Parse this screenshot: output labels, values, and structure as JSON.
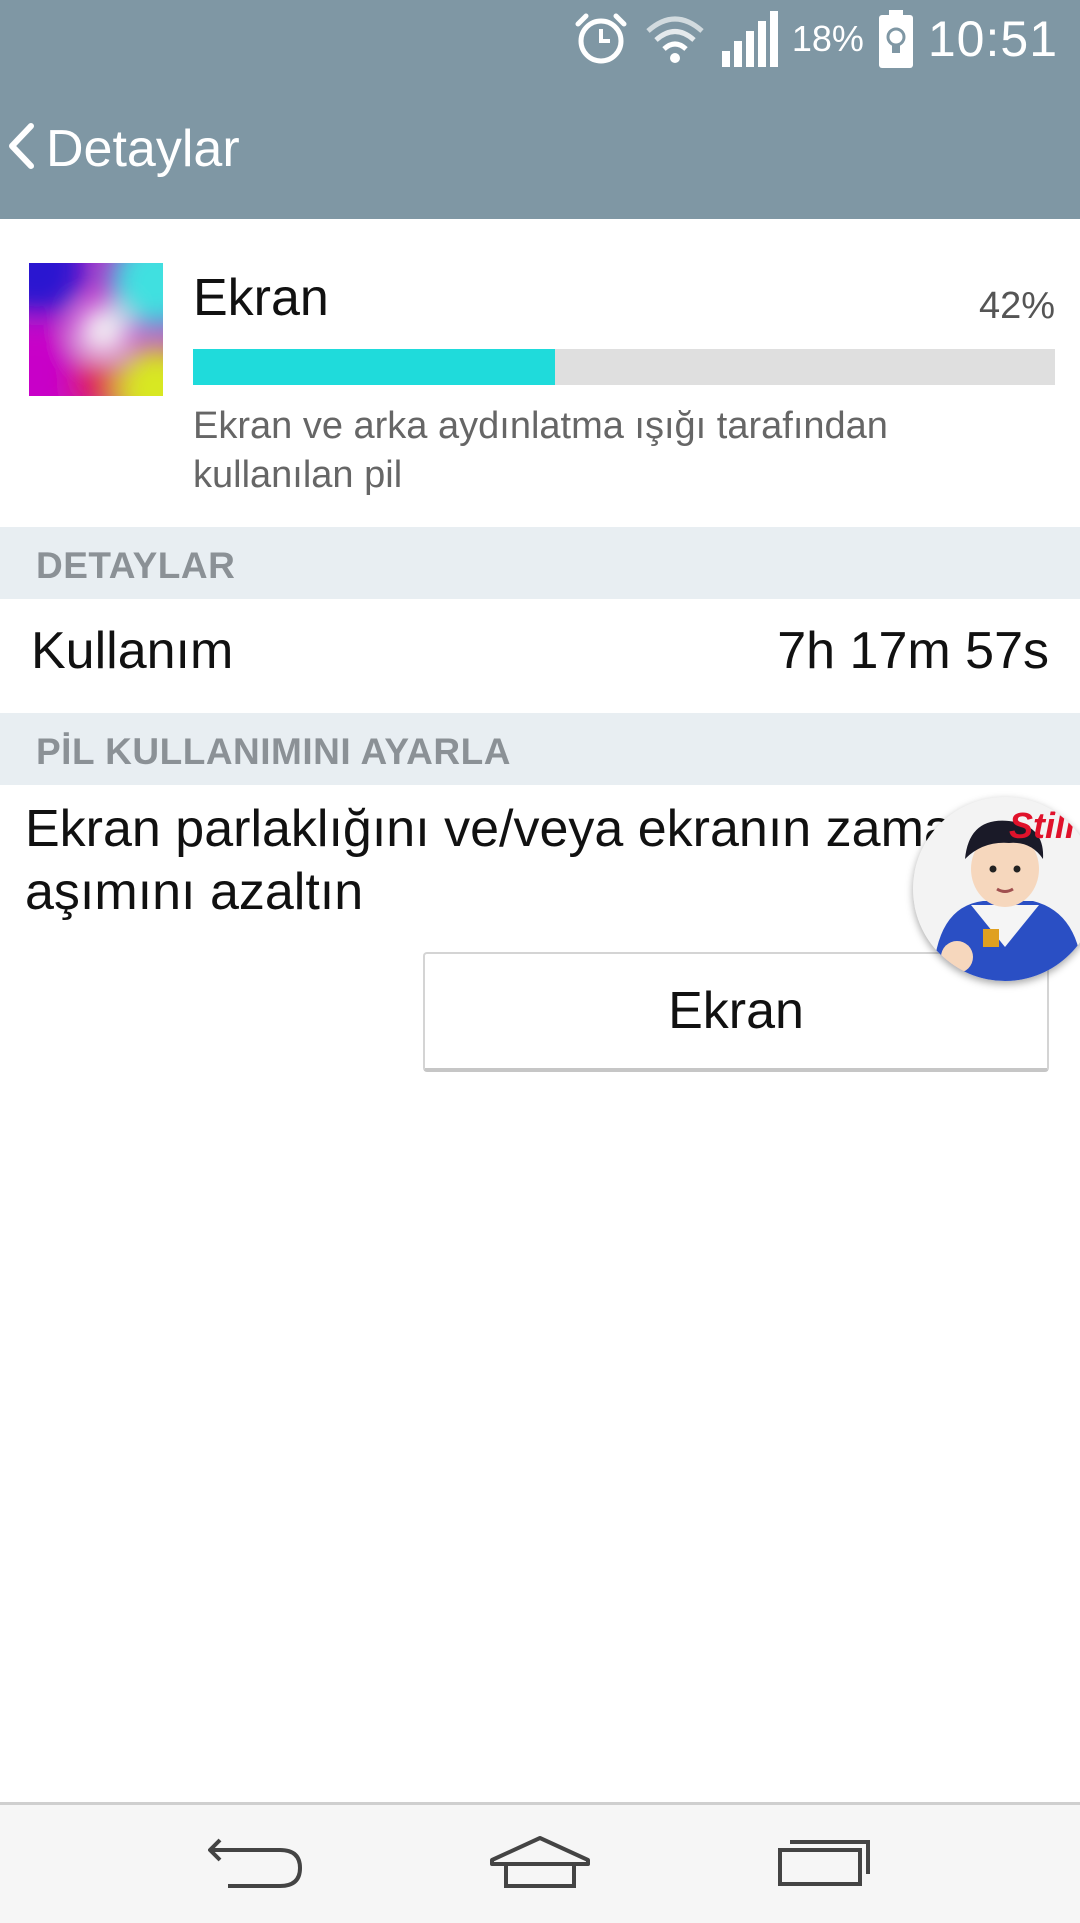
{
  "status_bar": {
    "battery_percent": "18%",
    "time": "10:51",
    "icons": [
      "alarm-icon",
      "wifi-icon",
      "signal-icon",
      "battery-icon"
    ]
  },
  "action_bar": {
    "back_icon": "chevron-left-icon",
    "title": "Detaylar"
  },
  "summary": {
    "title": "Ekran",
    "percent_label": "42%",
    "usage_fraction": 0.42,
    "description": "Ekran ve arka aydınlatma ışığı tarafından kullanılan pil",
    "bar_fill_color": "#1fdbdb",
    "bar_track_color": "#dfdfdf"
  },
  "details_section": {
    "header": "DETAYLAR",
    "rows": [
      {
        "label": "Kullanım",
        "value": "7h 17m 57s"
      }
    ]
  },
  "adjust_section": {
    "header": "PİL KULLANIMINI AYARLA",
    "tip": "Ekran parlaklığını ve/veya ekranın zaman aşımını azaltın",
    "button_label": "Ekran"
  },
  "floating_bubble": {
    "logo_text": "Still"
  },
  "nav_bar": {
    "buttons": [
      "back-nav-icon",
      "home-nav-icon",
      "recents-nav-icon"
    ]
  },
  "colors": {
    "bar_background": "#7f97a4",
    "section_header_bg": "#e8eef2",
    "accent_cyan": "#1fdbdb"
  }
}
